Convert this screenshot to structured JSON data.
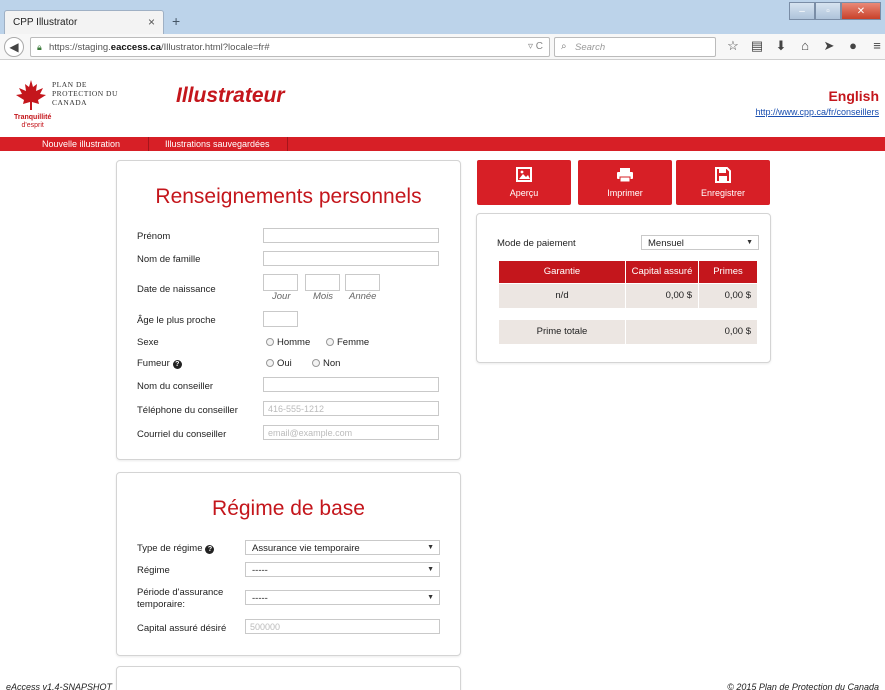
{
  "browser": {
    "tab_title": "CPP Illustrator",
    "tab_close": "×",
    "new_tab": "+",
    "url_prefix": "https://staging.",
    "url_domain": "eaccess.ca",
    "url_path": "/Illustrator.html?locale=fr#",
    "search_placeholder": "Search"
  },
  "header": {
    "logo_line1": "PLAN DE",
    "logo_line2": "PROTECTION DU",
    "logo_line3": "CANADA",
    "logo_tagline1": "Tranquillité",
    "logo_tagline2": "d'esprit",
    "app_title": "Illustrateur",
    "lang_link": "English",
    "site_link": "http://www.cpp.ca/fr/conseillers"
  },
  "menu": {
    "new_illustration": "Nouvelle illustration",
    "saved_illustrations": "Illustrations sauvegardées"
  },
  "personal": {
    "title": "Renseignements personnels",
    "first_name_label": "Prénom",
    "last_name_label": "Nom de famille",
    "dob_label": "Date de naissance",
    "day_label": "Jour",
    "month_label": "Mois",
    "year_label": "Année",
    "nearest_age_label": "Âge le plus proche",
    "sex_label": "Sexe",
    "sex_male": "Homme",
    "sex_female": "Femme",
    "smoker_label": "Fumeur",
    "smoker_yes": "Oui",
    "smoker_no": "Non",
    "advisor_name_label": "Nom du conseiller",
    "advisor_phone_label": "Téléphone du conseiller",
    "advisor_phone_placeholder": "416-555-1212",
    "advisor_email_label": "Courriel du conseiller",
    "advisor_email_placeholder": "email@example.com"
  },
  "base_plan": {
    "title": "Régime de base",
    "plan_type_label": "Type de régime",
    "plan_type_value": "Assurance vie temporaire",
    "plan_label": "Régime",
    "plan_value": "-----",
    "term_label_1": "Période d'assurance",
    "term_label_2": "temporaire:",
    "term_value": "-----",
    "coverage_label": "Capital assuré désiré",
    "coverage_placeholder": "500000"
  },
  "actions": {
    "preview": "Aperçu",
    "print": "Imprimer",
    "save": "Enregistrer"
  },
  "summary": {
    "payment_mode_label": "Mode de paiement",
    "payment_mode_value": "Mensuel",
    "col_coverage": "Garantie",
    "col_amount": "Capital assuré",
    "col_premium": "Primes",
    "row_coverage": "n/d",
    "row_amount": "0,00 $",
    "row_premium": "0,00 $",
    "total_label": "Prime totale",
    "total_value": "0,00 $"
  },
  "footer": {
    "version": "eAccess v1.4-SNAPSHOT",
    "copyright": "© 2015 Plan de Protection du Canada"
  },
  "colors": {
    "brand_red": "#d71f26",
    "link_blue": "#1a4fb0"
  }
}
